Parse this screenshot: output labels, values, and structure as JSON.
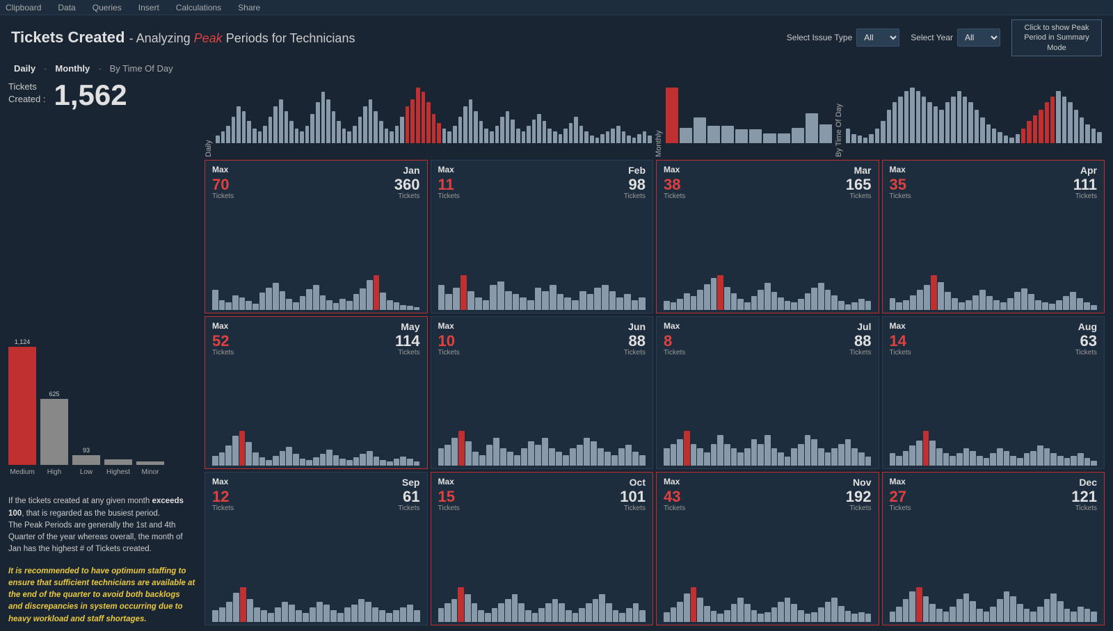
{
  "toolbar": {
    "items": [
      "Clipboard",
      "Data",
      "Queries",
      "Insert",
      "Calculations",
      "Share"
    ]
  },
  "header": {
    "title_main": "Tickets Created",
    "title_separator": " - ",
    "title_sub1": "Analyzing ",
    "title_peak": "Peak",
    "title_sub2": " Periods for Technicians",
    "select_issue_label": "Select Issue Type",
    "select_issue_value": "All",
    "select_year_label": "Select Year",
    "select_year_value": "All",
    "peak_mode_btn": "Click to show Peak Period in Summary Mode"
  },
  "nav": {
    "items": [
      "Daily",
      "-",
      "Monthly",
      "-",
      "By Time Of Day"
    ]
  },
  "left": {
    "stat_label": "Tickets\nCreated :",
    "stat_value": "1,562",
    "bars": [
      {
        "label": "Medium",
        "value": 1124,
        "color": "#c03030"
      },
      {
        "label": "High",
        "value": 625,
        "color": "#888"
      },
      {
        "label": "Low",
        "value": 93,
        "color": "#888"
      },
      {
        "label": "Highest",
        "value": 50,
        "color": "#888"
      },
      {
        "label": "Minor",
        "value": 30,
        "color": "#888"
      }
    ],
    "desc1": "If the tickets created at any given month ",
    "desc_bold": "exceeds 100",
    "desc2": ", that is regarded as the busiest period.\nThe Peak Periods are generally the 1st and 4th Quarter of the year whereas overall, the month of Jan has the highest # of Tickets created.",
    "recommendation": "It is recommended to have optimum staffing to ensure that sufficient technicians are available at the end of the quarter to avoid both backlogs and discrepancies in system occurring due to heavy workload and staff shortages."
  },
  "months": [
    {
      "name": "Jan",
      "max_val": "70",
      "total_val": "360",
      "peak": true,
      "bars": [
        40,
        20,
        15,
        30,
        25,
        18,
        12,
        35,
        45,
        55,
        38,
        22,
        16,
        28,
        42,
        50,
        30,
        20,
        14,
        22,
        18,
        32,
        44,
        60,
        70,
        35,
        20,
        15,
        10,
        8,
        5
      ]
    },
    {
      "name": "Feb",
      "max_val": "11",
      "total_val": "98",
      "peak": false,
      "bars": [
        8,
        5,
        7,
        11,
        6,
        4,
        3,
        8,
        9,
        6,
        5,
        4,
        3,
        7,
        6,
        8,
        5,
        4,
        3,
        6,
        5,
        7,
        8,
        6,
        4,
        5,
        3,
        4
      ]
    },
    {
      "name": "Mar",
      "max_val": "38",
      "total_val": "165",
      "peak": true,
      "bars": [
        10,
        8,
        12,
        18,
        15,
        22,
        28,
        35,
        38,
        25,
        18,
        12,
        8,
        15,
        22,
        30,
        20,
        14,
        10,
        8,
        12,
        18,
        24,
        30,
        22,
        16,
        10,
        6,
        8,
        12,
        10
      ]
    },
    {
      "name": "Apr",
      "max_val": "35",
      "total_val": "111",
      "peak": true,
      "bars": [
        12,
        8,
        10,
        15,
        20,
        25,
        35,
        28,
        18,
        12,
        8,
        10,
        15,
        20,
        14,
        10,
        8,
        12,
        18,
        22,
        16,
        10,
        8,
        6,
        10,
        14,
        18,
        12,
        8,
        5
      ]
    },
    {
      "name": "May",
      "max_val": "52",
      "total_val": "114",
      "peak": true,
      "bars": [
        15,
        20,
        30,
        45,
        52,
        35,
        20,
        12,
        8,
        15,
        22,
        28,
        18,
        10,
        8,
        12,
        18,
        24,
        16,
        10,
        8,
        12,
        18,
        22,
        14,
        8,
        6,
        10,
        14,
        10,
        6
      ]
    },
    {
      "name": "Jun",
      "max_val": "10",
      "total_val": "88",
      "peak": false,
      "bars": [
        5,
        6,
        8,
        10,
        7,
        4,
        3,
        6,
        8,
        5,
        4,
        3,
        5,
        7,
        6,
        8,
        5,
        4,
        3,
        5,
        6,
        8,
        7,
        5,
        4,
        3,
        5,
        6,
        4,
        3
      ]
    },
    {
      "name": "Jul",
      "max_val": "8",
      "total_val": "88",
      "peak": false,
      "bars": [
        4,
        5,
        6,
        8,
        5,
        4,
        3,
        5,
        7,
        5,
        4,
        3,
        4,
        6,
        5,
        7,
        4,
        3,
        2,
        4,
        5,
        7,
        6,
        4,
        3,
        4,
        5,
        6,
        4,
        3,
        2
      ]
    },
    {
      "name": "Aug",
      "max_val": "14",
      "total_val": "63",
      "peak": false,
      "bars": [
        5,
        4,
        6,
        8,
        10,
        14,
        10,
        7,
        5,
        4,
        5,
        7,
        6,
        4,
        3,
        5,
        7,
        6,
        4,
        3,
        5,
        6,
        8,
        7,
        5,
        4,
        3,
        4,
        5,
        3,
        2
      ]
    },
    {
      "name": "Sep",
      "max_val": "12",
      "total_val": "61",
      "peak": false,
      "bars": [
        4,
        5,
        7,
        10,
        12,
        8,
        5,
        4,
        3,
        5,
        7,
        6,
        4,
        3,
        5,
        7,
        6,
        4,
        3,
        5,
        6,
        8,
        7,
        5,
        4,
        3,
        4,
        5,
        6,
        4
      ]
    },
    {
      "name": "Oct",
      "max_val": "15",
      "total_val": "101",
      "peak": true,
      "bars": [
        6,
        8,
        10,
        15,
        12,
        8,
        5,
        4,
        6,
        8,
        10,
        12,
        8,
        5,
        4,
        6,
        8,
        10,
        8,
        5,
        4,
        6,
        8,
        10,
        12,
        8,
        5,
        4,
        6,
        8,
        5
      ]
    },
    {
      "name": "Nov",
      "max_val": "43",
      "total_val": "192",
      "peak": true,
      "bars": [
        12,
        18,
        25,
        35,
        43,
        30,
        20,
        14,
        10,
        15,
        22,
        30,
        22,
        15,
        10,
        12,
        18,
        25,
        30,
        22,
        15,
        10,
        12,
        18,
        25,
        30,
        20,
        14,
        10,
        12,
        10
      ]
    },
    {
      "name": "Dec",
      "max_val": "27",
      "total_val": "121",
      "peak": true,
      "bars": [
        8,
        12,
        18,
        24,
        27,
        20,
        14,
        10,
        8,
        12,
        18,
        22,
        16,
        10,
        8,
        12,
        18,
        24,
        20,
        14,
        10,
        8,
        12,
        18,
        22,
        16,
        10,
        8,
        12,
        10,
        8
      ]
    }
  ],
  "top_daily_bars": [
    5,
    8,
    12,
    18,
    25,
    22,
    15,
    10,
    8,
    12,
    18,
    25,
    30,
    22,
    15,
    10,
    8,
    12,
    20,
    28,
    35,
    30,
    22,
    15,
    10,
    8,
    12,
    18,
    25,
    30,
    22,
    15,
    10,
    8,
    12,
    18,
    25,
    30,
    38,
    35,
    28,
    20,
    14,
    10,
    8,
    12,
    18,
    25,
    30,
    22,
    15,
    10,
    8,
    12,
    18,
    22,
    16,
    10,
    8,
    12,
    16,
    20,
    15,
    10,
    8,
    6,
    10,
    14,
    18,
    12,
    8,
    5,
    4,
    6,
    8,
    10,
    12,
    8,
    5,
    4,
    6,
    8,
    5
  ],
  "top_monthly_bars": [
    360,
    98,
    165,
    111,
    114,
    88,
    88,
    63,
    61,
    101,
    192,
    121
  ],
  "top_time_bars": [
    8,
    5,
    4,
    3,
    5,
    8,
    12,
    18,
    22,
    25,
    28,
    30,
    28,
    25,
    22,
    20,
    18,
    22,
    25,
    28,
    25,
    22,
    18,
    14,
    10,
    8,
    6,
    4,
    3,
    5,
    8,
    12,
    15,
    18,
    22,
    25,
    28,
    25,
    22,
    18,
    14,
    10,
    8,
    6
  ]
}
